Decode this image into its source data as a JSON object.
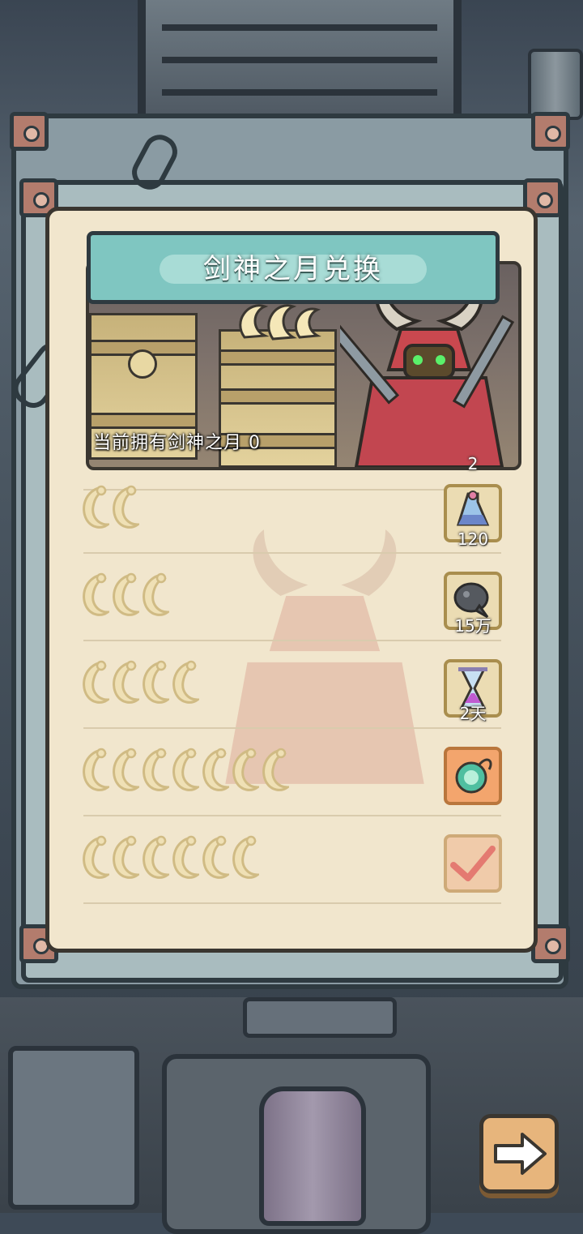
{
  "dialog": {
    "title": "剑神之月兑换",
    "owned_text": "当前拥有剑神之月  0"
  },
  "exchange_rows": [
    {
      "cost_icon_count": 2,
      "reward_icon": "potion-bottle-icon",
      "reward_qty": "120",
      "style": "normal"
    },
    {
      "cost_icon_count": 3,
      "reward_icon": "dark-blob-icon",
      "reward_qty": "15万",
      "style": "normal"
    },
    {
      "cost_icon_count": 4,
      "reward_icon": "hourglass-icon",
      "reward_qty": "2天",
      "style": "normal"
    },
    {
      "cost_icon_count": 7,
      "reward_icon": "green-amulet-icon",
      "reward_qty": "",
      "style": "orange"
    },
    {
      "cost_icon_count": 6,
      "reward_icon": "claimed-check-icon",
      "reward_qty": "",
      "style": "done"
    }
  ],
  "partial_top_row_qty": "2",
  "colors": {
    "paper": "#f1e6cd",
    "title_plate": "#7fc6c1",
    "moon": "#efe0b5",
    "frame": "#8a9ba3",
    "next_button": "#e7b57c"
  }
}
